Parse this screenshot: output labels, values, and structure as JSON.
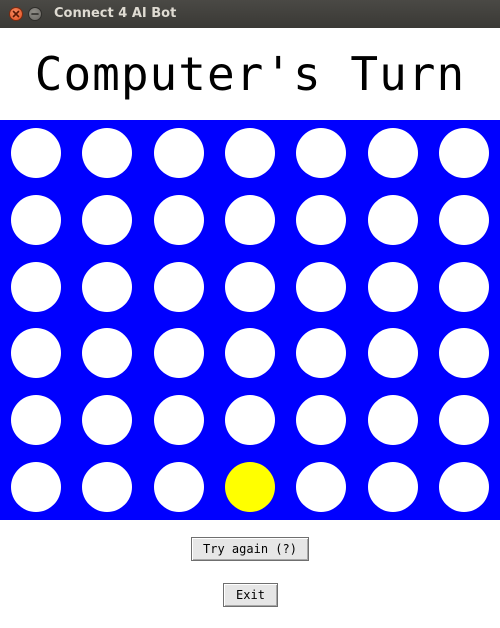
{
  "window": {
    "title": "Connect 4 AI Bot",
    "controls": [
      "close-icon",
      "minimize-icon"
    ]
  },
  "status": {
    "text": "Computer's Turn"
  },
  "board": {
    "rows": 6,
    "columns": 7,
    "colors": {
      "board": "#0000ff",
      "empty": "#ffffff",
      "yellow": "#ffff00"
    },
    "cells": [
      [
        "empty",
        "empty",
        "empty",
        "empty",
        "empty",
        "empty",
        "empty"
      ],
      [
        "empty",
        "empty",
        "empty",
        "empty",
        "empty",
        "empty",
        "empty"
      ],
      [
        "empty",
        "empty",
        "empty",
        "empty",
        "empty",
        "empty",
        "empty"
      ],
      [
        "empty",
        "empty",
        "empty",
        "empty",
        "empty",
        "empty",
        "empty"
      ],
      [
        "empty",
        "empty",
        "empty",
        "empty",
        "empty",
        "empty",
        "empty"
      ],
      [
        "empty",
        "empty",
        "empty",
        "yellow",
        "empty",
        "empty",
        "empty"
      ]
    ]
  },
  "buttons": {
    "try_again": "Try again (?)",
    "exit": "Exit"
  }
}
